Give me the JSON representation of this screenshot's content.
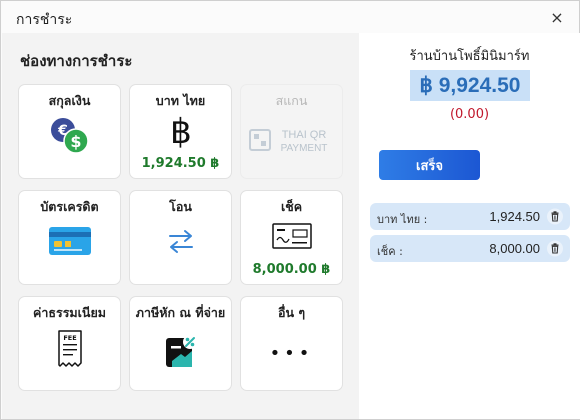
{
  "window": {
    "title": "การชำระ",
    "close_icon": "×"
  },
  "left": {
    "section_title": "ช่องทางการชำระ",
    "methods": [
      {
        "label": "สกุลเงิน",
        "amount": "",
        "icon": "currency-exchange-icon",
        "enabled": true
      },
      {
        "label": "บาท ไทย",
        "amount": "1,924.50 ฿",
        "icon": "baht-icon",
        "enabled": true
      },
      {
        "label": "สแกน",
        "amount": "",
        "icon": "thai-qr-payment-icon",
        "enabled": false,
        "icon_text_1": "THAI QR",
        "icon_text_2": "PAYMENT"
      },
      {
        "label": "บัตรเครดิต",
        "amount": "",
        "icon": "credit-card-icon",
        "enabled": true
      },
      {
        "label": "โอน",
        "amount": "",
        "icon": "transfer-arrows-icon",
        "enabled": true
      },
      {
        "label": "เช็ค",
        "amount": "8,000.00 ฿",
        "icon": "cheque-icon",
        "enabled": true
      },
      {
        "label": "ค่าธรรมเนียม",
        "amount": "",
        "icon": "fee-receipt-icon",
        "enabled": true,
        "icon_text": "FEE"
      },
      {
        "label": "ภาษีหัก ณ ที่จ่าย",
        "amount": "",
        "icon": "tax-withholding-icon",
        "enabled": true
      },
      {
        "label": "อื่น ๆ",
        "amount": "",
        "icon": "more-icon",
        "enabled": true,
        "icon_text": "•••"
      }
    ]
  },
  "right": {
    "shop_name": "ร้านบ้านโพธิ์มินิมาร์ท",
    "total": "฿ 9,924.50",
    "change": "(0.00)",
    "done_label": "เสร็จ",
    "payments": [
      {
        "method": "บาท ไทย :",
        "amount": "1,924.50"
      },
      {
        "method": "เช็ค :",
        "amount": "8,000.00"
      }
    ]
  },
  "colors": {
    "accent": "#2f7de6",
    "amount_green": "#1f7a2c",
    "change_red": "#c0172b",
    "total_bg": "#c9e0f7",
    "row_bg": "#d7e7f8"
  }
}
